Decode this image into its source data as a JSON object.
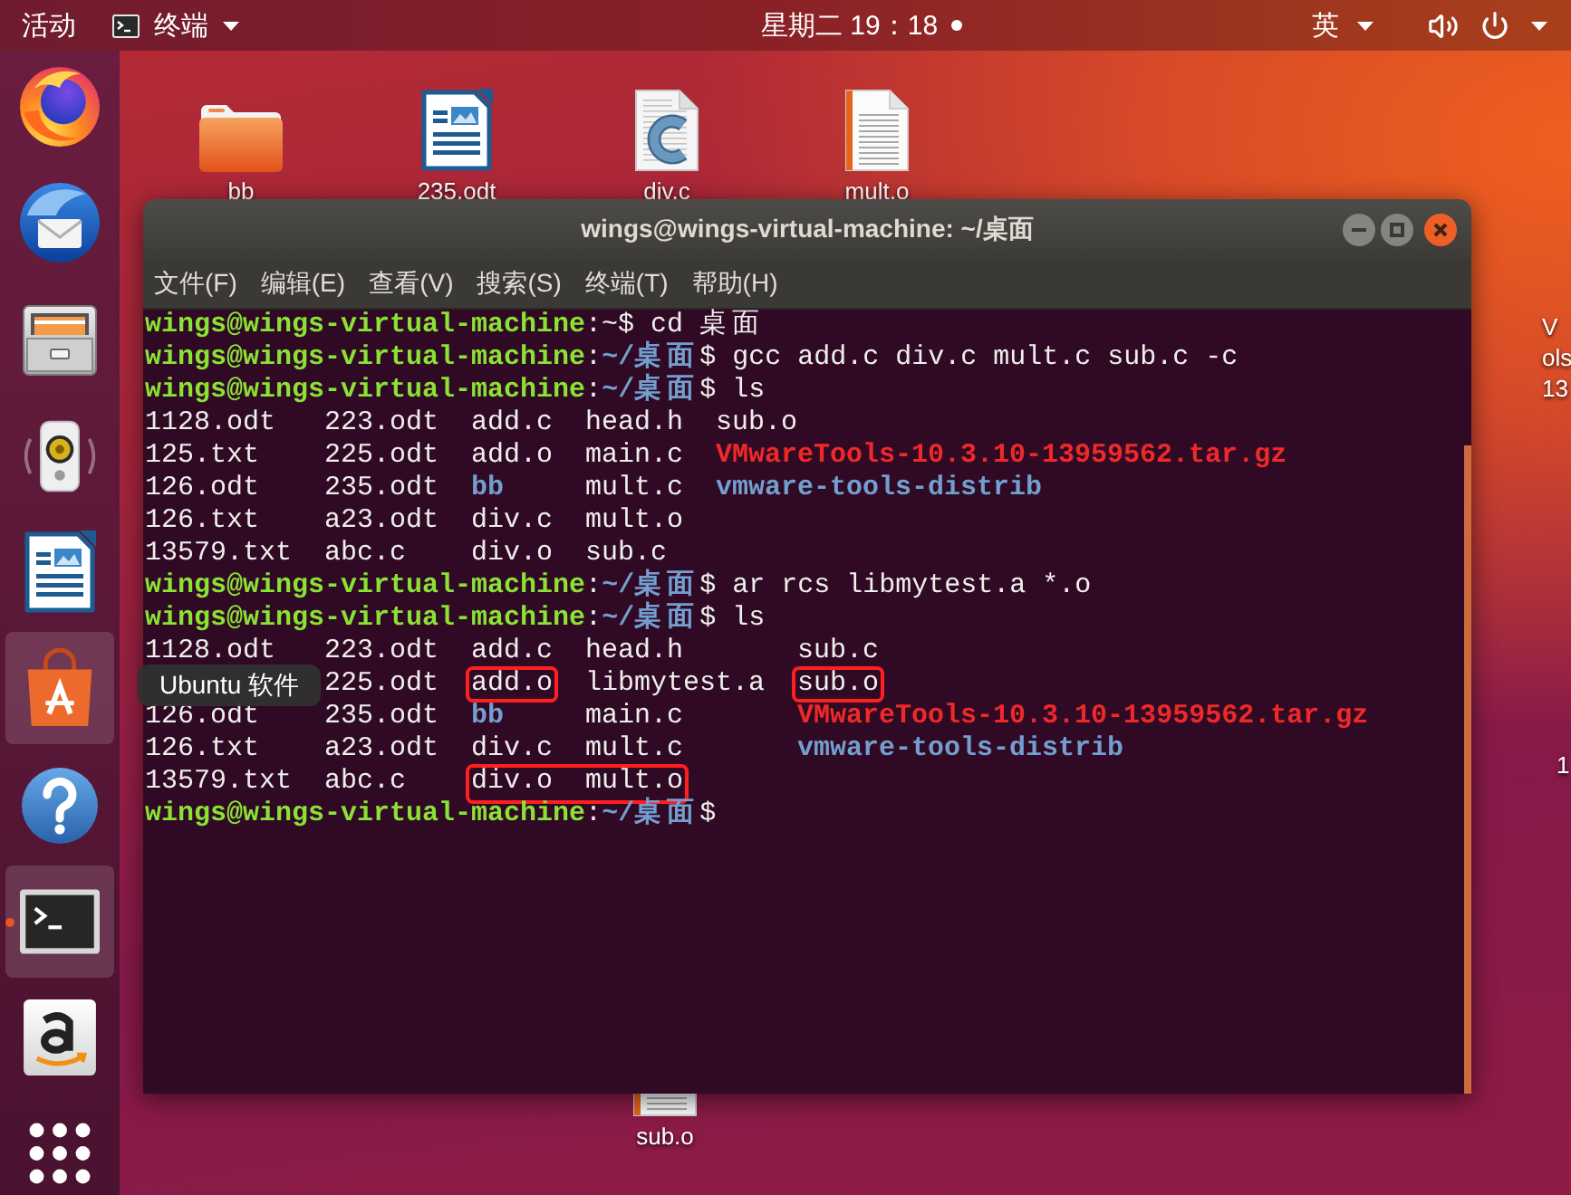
{
  "top_bar": {
    "activities": "活动",
    "app_menu": "终端",
    "clock": "星期二 19：18",
    "notification": true,
    "input_method": "英"
  },
  "dock": {
    "items": [
      {
        "kind": "browser",
        "highlighted": false,
        "running": false
      },
      {
        "kind": "mail",
        "highlighted": false,
        "running": false
      },
      {
        "kind": "files",
        "highlighted": false,
        "running": false
      },
      {
        "kind": "music",
        "highlighted": false,
        "running": false
      },
      {
        "kind": "writer",
        "highlighted": false,
        "running": false
      },
      {
        "kind": "software",
        "highlighted": true,
        "running": false
      },
      {
        "kind": "help",
        "highlighted": false,
        "running": false
      },
      {
        "kind": "terminal",
        "highlighted": true,
        "running": true
      },
      {
        "kind": "shop",
        "highlighted": false,
        "running": false
      },
      {
        "kind": "apps",
        "highlighted": false,
        "running": false
      }
    ]
  },
  "desktop": {
    "icons": [
      {
        "kind": "folder",
        "label": "bb"
      },
      {
        "kind": "writer",
        "label": "235.odt"
      },
      {
        "kind": "c_source",
        "label": "div.c"
      },
      {
        "kind": "text",
        "label": "mult.o"
      },
      {
        "kind": "text",
        "label": "sub.o"
      }
    ],
    "edge_labels": [
      {
        "lines": [
          "V",
          "ols",
          "13"
        ]
      },
      {
        "lines": [
          "1"
        ]
      }
    ]
  },
  "terminal": {
    "title": "wings@wings-virtual-machine: ~/桌面",
    "menu": [
      "文件(F)",
      "编辑(E)",
      "查看(V)",
      "搜索(S)",
      "终端(T)",
      "帮助(H)"
    ],
    "lines": [
      {
        "kind": "prompt",
        "segments": [
          {
            "text": "wings@wings-virtual-machine",
            "kind": "user"
          },
          {
            "text": ":~$ cd 桌面",
            "kind": "plain"
          }
        ]
      },
      {
        "kind": "prompt",
        "segments": [
          {
            "text": "wings@wings-virtual-machine",
            "kind": "user"
          },
          {
            "text": ":",
            "kind": "plain"
          },
          {
            "text": "~/桌面",
            "kind": "path"
          },
          {
            "text": "$ gcc add.c div.c mult.c sub.c -c",
            "kind": "plain"
          }
        ]
      },
      {
        "kind": "prompt",
        "segments": [
          {
            "text": "wings@wings-virtual-machine",
            "kind": "user"
          },
          {
            "text": ":",
            "kind": "plain"
          },
          {
            "text": "~/桌面",
            "kind": "path"
          },
          {
            "text": "$ ls",
            "kind": "plain"
          }
        ]
      },
      {
        "kind": "listing",
        "rows": [
          [
            {
              "name": "1128.odt",
              "kind": "file",
              "boxed": false
            },
            {
              "name": "223.odt",
              "kind": "file",
              "boxed": false
            },
            {
              "name": "add.c",
              "kind": "file",
              "boxed": false
            },
            {
              "name": "head.h",
              "kind": "file",
              "boxed": false
            },
            {
              "name": "sub.o",
              "kind": "file",
              "boxed": false
            }
          ],
          [
            {
              "name": "125.txt",
              "kind": "file",
              "boxed": false
            },
            {
              "name": "225.odt",
              "kind": "file",
              "boxed": false
            },
            {
              "name": "add.o",
              "kind": "file",
              "boxed": false
            },
            {
              "name": "main.c",
              "kind": "file",
              "boxed": false
            },
            {
              "name": "VMwareTools-10.3.10-13959562.tar.gz",
              "kind": "archive",
              "boxed": false
            }
          ],
          [
            {
              "name": "126.odt",
              "kind": "file",
              "boxed": false
            },
            {
              "name": "235.odt",
              "kind": "file",
              "boxed": false
            },
            {
              "name": "bb",
              "kind": "dir",
              "boxed": false
            },
            {
              "name": "mult.c",
              "kind": "file",
              "boxed": false
            },
            {
              "name": "vmware-tools-distrib",
              "kind": "dir",
              "boxed": false
            }
          ],
          [
            {
              "name": "126.txt",
              "kind": "file",
              "boxed": false
            },
            {
              "name": "a23.odt",
              "kind": "file",
              "boxed": false
            },
            {
              "name": "div.c",
              "kind": "file",
              "boxed": false
            },
            {
              "name": "mult.o",
              "kind": "file",
              "boxed": false
            }
          ],
          [
            {
              "name": "13579.txt",
              "kind": "file",
              "boxed": false
            },
            {
              "name": "abc.c",
              "kind": "file",
              "boxed": false
            },
            {
              "name": "div.o",
              "kind": "file",
              "boxed": false
            },
            {
              "name": "sub.c",
              "kind": "file",
              "boxed": false
            }
          ]
        ]
      },
      {
        "kind": "prompt",
        "segments": [
          {
            "text": "wings@wings-virtual-machine",
            "kind": "user"
          },
          {
            "text": ":",
            "kind": "plain"
          },
          {
            "text": "~/桌面",
            "kind": "path"
          },
          {
            "text": "$ ar rcs libmytest.a *.o",
            "kind": "plain"
          }
        ]
      },
      {
        "kind": "prompt",
        "segments": [
          {
            "text": "wings@wings-virtual-machine",
            "kind": "user"
          },
          {
            "text": ":",
            "kind": "plain"
          },
          {
            "text": "~/桌面",
            "kind": "path"
          },
          {
            "text": "$ ls",
            "kind": "plain"
          }
        ]
      },
      {
        "kind": "listing",
        "rows": [
          [
            {
              "name": "1128.odt",
              "kind": "file",
              "boxed": false
            },
            {
              "name": "223.odt",
              "kind": "file",
              "boxed": false
            },
            {
              "name": "add.c",
              "kind": "file",
              "boxed": false
            },
            {
              "name": "head.h",
              "kind": "file",
              "boxed": false
            },
            {
              "name": "sub.c",
              "kind": "file",
              "boxed": false
            }
          ],
          [
            null,
            {
              "name": "225.odt",
              "kind": "file",
              "boxed": false
            },
            {
              "name": "add.o",
              "kind": "file",
              "boxed": true
            },
            {
              "name": "libmytest.a",
              "kind": "file",
              "boxed": false
            },
            {
              "name": "sub.o",
              "kind": "file",
              "boxed": true
            }
          ],
          [
            {
              "name": "126.odt",
              "kind": "file",
              "boxed": false
            },
            {
              "name": "235.odt",
              "kind": "file",
              "boxed": false
            },
            {
              "name": "bb",
              "kind": "dir",
              "boxed": false
            },
            {
              "name": "main.c",
              "kind": "file",
              "boxed": false
            },
            {
              "name": "VMwareTools-10.3.10-13959562.tar.gz",
              "kind": "archive",
              "boxed": false
            }
          ],
          [
            {
              "name": "126.txt",
              "kind": "file",
              "boxed": false
            },
            {
              "name": "a23.odt",
              "kind": "file",
              "boxed": false
            },
            {
              "name": "div.c",
              "kind": "file",
              "boxed": false
            },
            {
              "name": "mult.c",
              "kind": "file",
              "boxed": false
            },
            {
              "name": "vmware-tools-distrib",
              "kind": "dir",
              "boxed": false
            }
          ],
          [
            {
              "name": "13579.txt",
              "kind": "file",
              "boxed": false
            },
            {
              "name": "abc.c",
              "kind": "file",
              "boxed": false
            },
            {
              "name": "div.o",
              "kind": "file",
              "boxed": true
            },
            {
              "name": "mult.o",
              "kind": "file",
              "boxed": true
            }
          ]
        ]
      },
      {
        "kind": "prompt",
        "segments": [
          {
            "text": "wings@wings-virtual-machine",
            "kind": "user"
          },
          {
            "text": ":",
            "kind": "plain"
          },
          {
            "text": "~/桌面",
            "kind": "path"
          },
          {
            "text": "$",
            "kind": "plain"
          }
        ]
      }
    ]
  },
  "tooltip": {
    "text": "Ubuntu 软件"
  }
}
